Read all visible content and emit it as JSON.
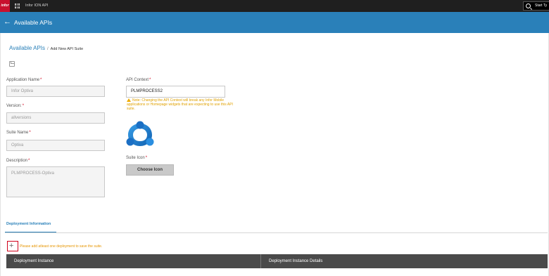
{
  "topbar": {
    "logo_text": "infor",
    "app_title": "Infor ION API",
    "search_placeholder": "Start Ty"
  },
  "header": {
    "title": "Available APIs"
  },
  "breadcrumb": {
    "link": "Available APIs",
    "separator": "/",
    "current": "Add New API Suite"
  },
  "form": {
    "application_name": {
      "label": "Application Name",
      "value": "Infor Optiva"
    },
    "version": {
      "label": "Version:",
      "value": "allversions"
    },
    "suite_name": {
      "label": "Suite Name",
      "value": "Optiva"
    },
    "description": {
      "label": "Description",
      "value": "PLMPROCESS-Optiva"
    },
    "api_context": {
      "label": "API Context",
      "value": "PLMPROCESS2"
    },
    "warning": "Note: Changing the API Context will break any Infor Mobile applications or Homepage widgets that are expecting to use this API suite.",
    "suite_icon": {
      "label": "Suite Icon",
      "button_label": "Choose Icon"
    },
    "required_mark": "*"
  },
  "deployment": {
    "tab_label": "Deployment Information",
    "add_note": "Please add atleast one deployment to save the suite.",
    "columns": [
      "Deployment Instance",
      "Deployment Instance Details"
    ]
  },
  "colors": {
    "header_blue": "#2a80b9",
    "warning": "#e69500",
    "required": "#d0021b"
  }
}
